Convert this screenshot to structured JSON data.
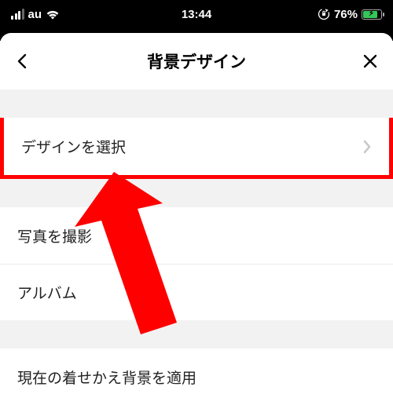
{
  "status": {
    "carrier": "au",
    "time": "13:44",
    "battery_pct": "76%"
  },
  "nav": {
    "title": "背景デザイン"
  },
  "list": {
    "select_design": "デザインを選択",
    "take_photo": "写真を撮影",
    "album": "アルバム",
    "apply_theme_bg": "現在の着せかえ背景を適用"
  }
}
